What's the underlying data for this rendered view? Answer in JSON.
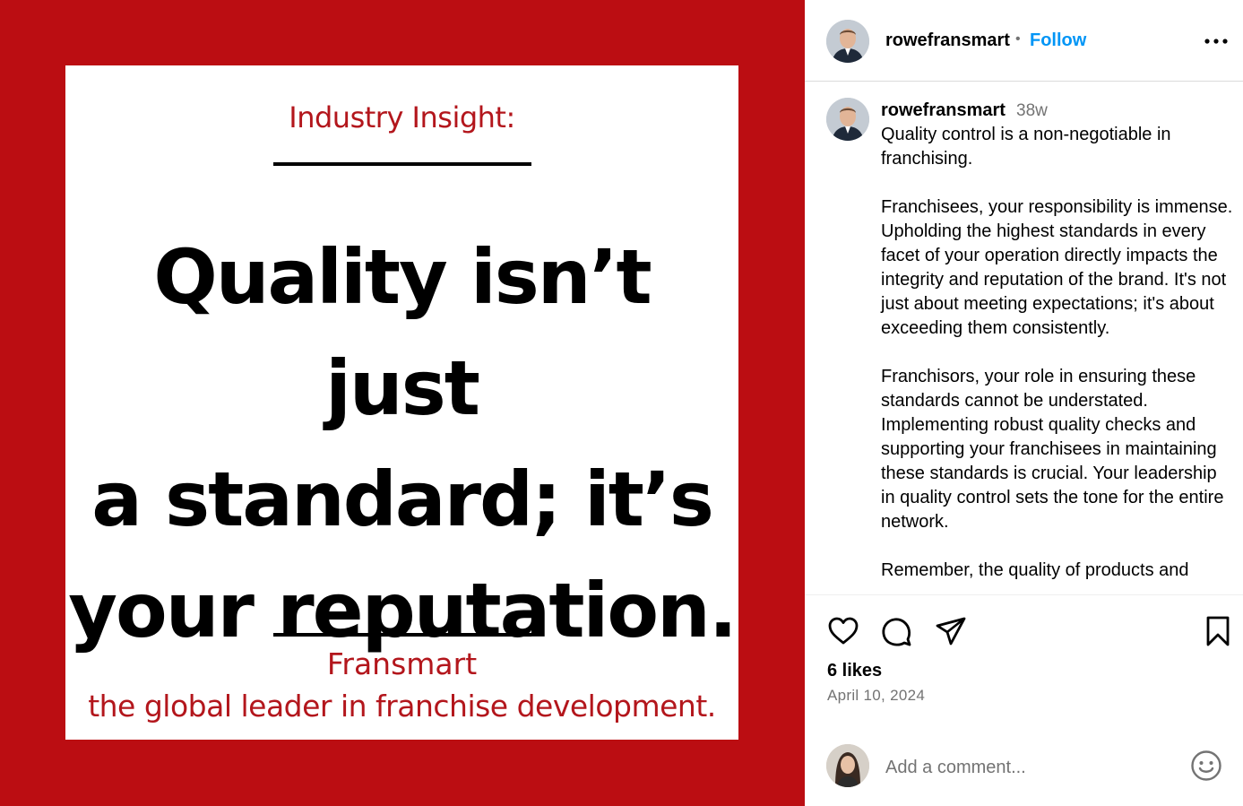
{
  "post": {
    "kicker": "Industry Insight:",
    "headline_lines": [
      "Quality isn’t just",
      "a standard; it’s",
      "your reputation."
    ],
    "brand": "Fransmart",
    "tagline": "the global leader in franchise development.",
    "colors": {
      "background": "#bb0d12",
      "card": "#ffffff",
      "accent_text": "#b3161c"
    }
  },
  "header": {
    "username": "rowefransmart",
    "separator": "•",
    "follow_label": "Follow",
    "more_icon": "more-horizontal-icon"
  },
  "caption": {
    "username": "rowefransmart",
    "time": "38w",
    "text": "Quality control is a non-negotiable in franchising.\n\nFranchisees, your responsibility is immense. Upholding the highest standards in every facet of your operation directly impacts the integrity and reputation of the brand. It's not just about meeting expectations; it's about exceeding them consistently.\n\nFranchisors, your role in ensuring these standards cannot be understated. Implementing robust quality checks and supporting your franchisees in maintaining these standards is crucial. Your leadership in quality control sets the tone for the entire network.\n\nRemember, the quality of products and"
  },
  "actions": {
    "icons": [
      "heart-icon",
      "comment-icon",
      "share-icon",
      "bookmark-icon"
    ]
  },
  "likes": "6 likes",
  "date": "April 10, 2024",
  "comment": {
    "placeholder": "Add a comment...",
    "emoji_icon": "emoji-icon"
  },
  "colors": {
    "link": "#0095f6",
    "muted": "#737373",
    "border": "#dbdbdb"
  }
}
